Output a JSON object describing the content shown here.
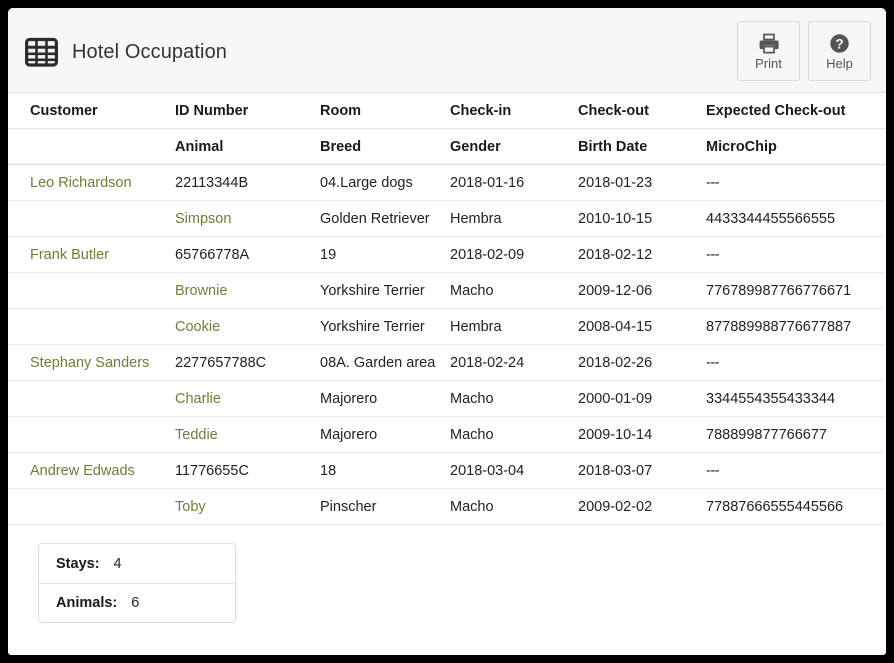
{
  "header": {
    "icon": "table-grid-icon",
    "title": "Hotel Occupation",
    "actions": [
      {
        "icon": "printer-icon",
        "label": "Print"
      },
      {
        "icon": "question-circle-icon",
        "label": "Help"
      }
    ]
  },
  "table": {
    "header_row_1": [
      "Customer",
      "ID Number",
      "Room",
      "Check-in",
      "Check-out",
      "Expected Check-out"
    ],
    "header_row_2": [
      "",
      "Animal",
      "Breed",
      "Gender",
      "Birth Date",
      "MicroChip"
    ],
    "rows": [
      {
        "type": "stay",
        "cells": [
          "Leo Richardson",
          "22113344B",
          "04.Large dogs",
          "2018-01-16",
          "2018-01-23",
          "---"
        ]
      },
      {
        "type": "animal",
        "cells": [
          "",
          "Simpson",
          "Golden Retriever",
          "Hembra",
          "2010-10-15",
          "4433344455566555"
        ]
      },
      {
        "type": "stay",
        "cells": [
          "Frank Butler",
          "65766778A",
          "19",
          "2018-02-09",
          "2018-02-12",
          "---"
        ]
      },
      {
        "type": "animal",
        "cells": [
          "",
          "Brownie",
          "Yorkshire Terrier",
          "Macho",
          "2009-12-06",
          "776789987766776671"
        ]
      },
      {
        "type": "animal",
        "cells": [
          "",
          "Cookie",
          "Yorkshire Terrier",
          "Hembra",
          "2008-04-15",
          "877889988776677887"
        ]
      },
      {
        "type": "stay",
        "cells": [
          "Stephany Sanders",
          "2277657788C",
          "08A. Garden area",
          "2018-02-24",
          "2018-02-26",
          "---"
        ]
      },
      {
        "type": "animal",
        "cells": [
          "",
          "Charlie",
          "Majorero",
          "Macho",
          "2000-01-09",
          "3344554355433344"
        ]
      },
      {
        "type": "animal",
        "cells": [
          "",
          "Teddie",
          "Majorero",
          "Macho",
          "2009-10-14",
          "788899877766677"
        ]
      },
      {
        "type": "stay",
        "cells": [
          "Andrew Edwads",
          "11776655C",
          "18",
          "2018-03-04",
          "2018-03-07",
          "---"
        ]
      },
      {
        "type": "animal",
        "cells": [
          "",
          "Toby",
          "Pinscher",
          "Macho",
          "2009-02-02",
          "77887666555445566"
        ]
      }
    ]
  },
  "summary": {
    "rows": [
      {
        "label": "Stays:",
        "value": "4"
      },
      {
        "label": "Animals:",
        "value": "6"
      }
    ]
  },
  "colors": {
    "name_green": "#6e7d3b",
    "header_bg": "#f7f7f7",
    "text": "#222222"
  }
}
